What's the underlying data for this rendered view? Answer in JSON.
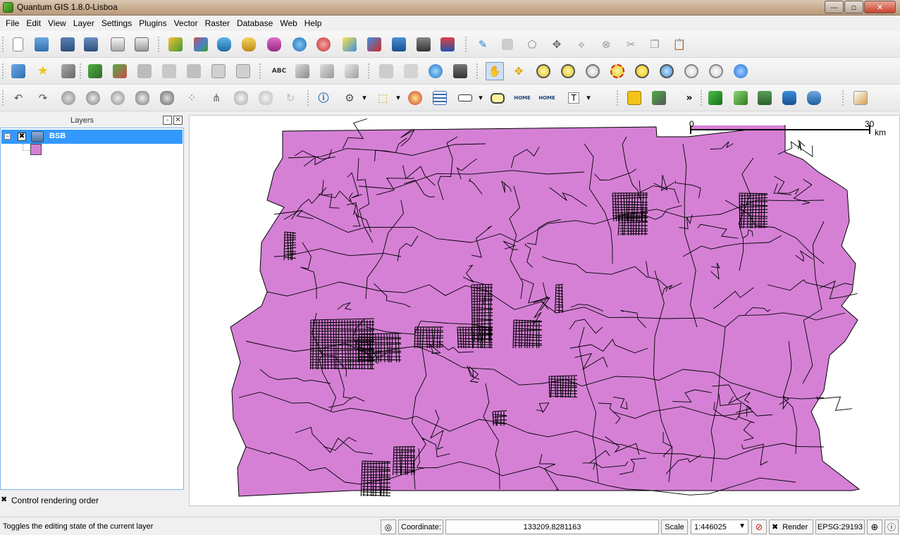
{
  "window": {
    "title": "Quantum GIS 1.8.0-Lisboa",
    "controls": {
      "minimize": "—",
      "maximize": "▫",
      "close": "✕"
    }
  },
  "menu": [
    "File",
    "Edit",
    "View",
    "Layer",
    "Settings",
    "Plugins",
    "Vector",
    "Raster",
    "Database",
    "Web",
    "Help"
  ],
  "layers_panel": {
    "title": "Layers",
    "float_glyph": "▫",
    "close_glyph": "✕",
    "layer": {
      "name": "BSB",
      "visible": true,
      "fill_color": "#d580d5",
      "expander": "−",
      "check_glyph": "✖"
    },
    "control_rendering_order": {
      "label": "Control rendering order",
      "checked": true,
      "check_glyph": "✖"
    }
  },
  "map": {
    "fill_color": "#d580d5",
    "stroke_color": "#000000",
    "scalebar": {
      "start": "0",
      "end": "30",
      "unit": "km"
    }
  },
  "status": {
    "message": "Toggles the editing state of the current layer",
    "coordinate_label": "Coordinate:",
    "coordinate_value": "133209,8281163",
    "scale_label": "Scale",
    "scale_value": "1:446025",
    "render_label": "Render",
    "render_checked": true,
    "render_check_glyph": "✖",
    "dropdown_glyph": "▼",
    "crs": "EPSG:29193"
  },
  "toolbar_glyphs": {
    "overflow": "»",
    "label_text": "ABC",
    "home_text": "HOME",
    "dropdown": "▾"
  },
  "colors": {
    "selection": "#3399ff",
    "polygon_fill": "#d580d5",
    "title_bar": "#c7ab8d"
  }
}
